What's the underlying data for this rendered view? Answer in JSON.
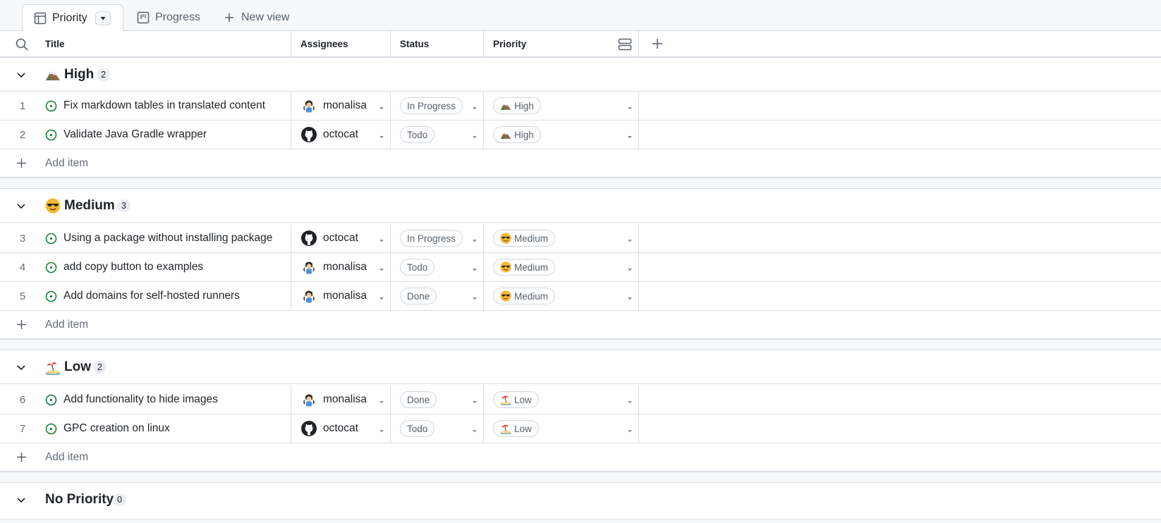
{
  "tabs": [
    {
      "label": "Priority",
      "icon": "table-icon",
      "active": true
    },
    {
      "label": "Progress",
      "icon": "board-icon",
      "active": false
    },
    {
      "label": "New view",
      "icon": "plus-icon",
      "active": false
    }
  ],
  "columns": {
    "title": "Title",
    "assignees": "Assignees",
    "status": "Status",
    "priority": "Priority"
  },
  "groups": [
    {
      "label": "High",
      "count": "2",
      "emoji": "mountain",
      "rows": [
        {
          "num": "1",
          "title": "Fix markdown tables in translated content",
          "assignee": "monalisa",
          "status": "In Progress",
          "priority": "High"
        },
        {
          "num": "2",
          "title": "Validate Java Gradle wrapper",
          "assignee": "octocat",
          "status": "Todo",
          "priority": "High"
        }
      ]
    },
    {
      "label": "Medium",
      "count": "3",
      "emoji": "sunglasses",
      "rows": [
        {
          "num": "3",
          "title": "Using a package without installing package",
          "assignee": "octocat",
          "status": "In Progress",
          "priority": "Medium"
        },
        {
          "num": "4",
          "title": "add copy button to examples",
          "assignee": "monalisa",
          "status": "Todo",
          "priority": "Medium"
        },
        {
          "num": "5",
          "title": "Add domains for self-hosted runners",
          "assignee": "monalisa",
          "status": "Done",
          "priority": "Medium"
        }
      ]
    },
    {
      "label": "Low",
      "count": "2",
      "emoji": "beach",
      "rows": [
        {
          "num": "6",
          "title": "Add functionality to hide images",
          "assignee": "monalisa",
          "status": "Done",
          "priority": "Low"
        },
        {
          "num": "7",
          "title": "GPC creation on linux",
          "assignee": "octocat",
          "status": "Todo",
          "priority": "Low"
        }
      ]
    },
    {
      "label": "No Priority",
      "count": "0",
      "emoji": "",
      "rows": []
    }
  ],
  "add_item_label": "Add item",
  "colors": {
    "open_issue": "#1a7f37",
    "border": "#d0d7de",
    "muted": "#656d76"
  }
}
